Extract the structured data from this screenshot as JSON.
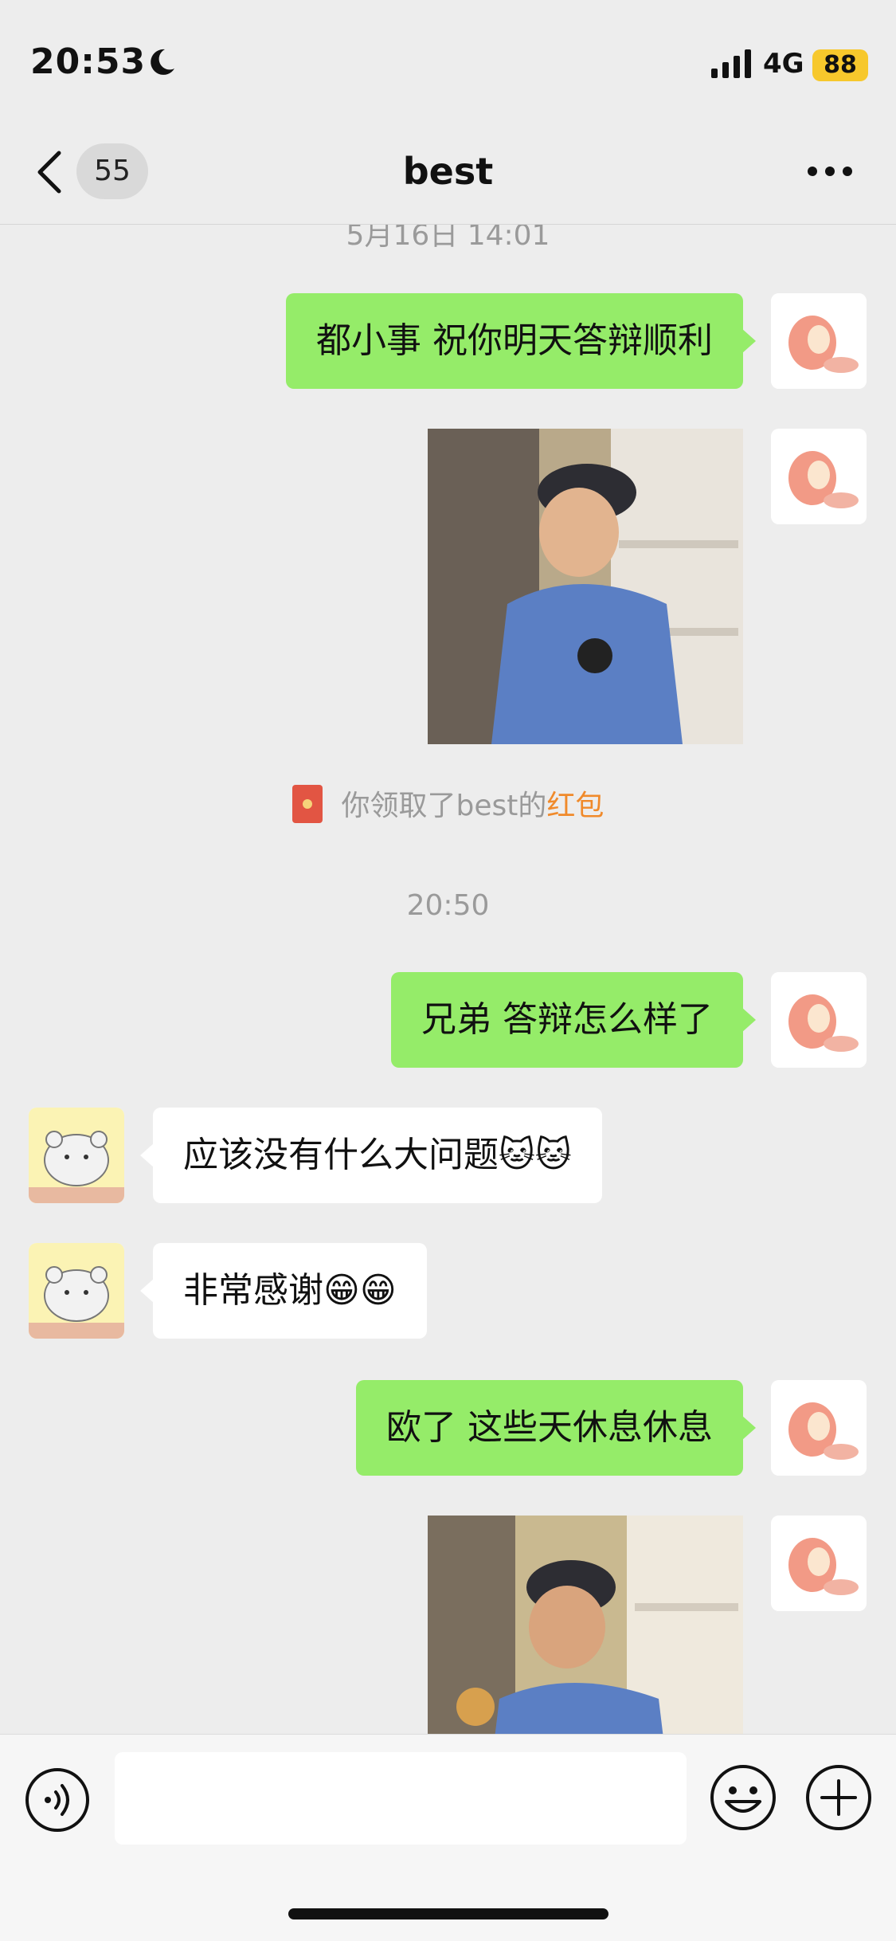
{
  "status_bar": {
    "time": "20:53",
    "network": "4G",
    "battery": "88"
  },
  "nav": {
    "unread_count": "55",
    "title": "best"
  },
  "messages": [
    {
      "type": "timestamp",
      "text": "5月16日 14:01"
    },
    {
      "type": "text",
      "direction": "out",
      "text": "都小事 祝你明天答辩顺利"
    },
    {
      "type": "image",
      "direction": "out",
      "description": "meme-dancing-man"
    },
    {
      "type": "system",
      "prefix": "你领取了best的",
      "link": "红包"
    },
    {
      "type": "timestamp",
      "text": "20:50"
    },
    {
      "type": "text",
      "direction": "out",
      "text": "兄弟 答辩怎么样了"
    },
    {
      "type": "text",
      "direction": "in",
      "text": "应该没有什么大问题🐱🐱"
    },
    {
      "type": "text",
      "direction": "in",
      "text": "非常感谢😁😁"
    },
    {
      "type": "text",
      "direction": "out",
      "text": "欧了 这些天休息休息"
    },
    {
      "type": "image",
      "direction": "out",
      "description": "meme-dancing-man"
    }
  ],
  "input": {
    "placeholder": ""
  },
  "colors": {
    "outgoing_bubble": "#95ec69",
    "incoming_bubble": "#ffffff",
    "background": "#ededed",
    "red_packet_link": "#f08a2b"
  },
  "icons": [
    "moon-icon",
    "signal-icon",
    "back-chevron-icon",
    "more-dots-icon",
    "voice-icon",
    "emoji-icon",
    "plus-icon",
    "red-packet-icon",
    "peach-avatar",
    "hamster-avatar"
  ]
}
